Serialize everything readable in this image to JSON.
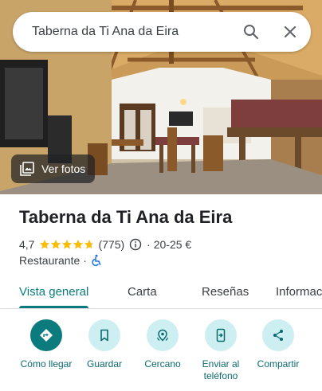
{
  "search": {
    "query": "Taberna da Ti Ana da Eira",
    "search_icon": "search-icon",
    "close_icon": "close-icon"
  },
  "hero": {
    "photos_label": "Ver fotos",
    "photos_icon": "photo-library-icon"
  },
  "place": {
    "title": "Taberna da Ti Ana da Eira",
    "rating": "4,7",
    "stars": 4.7,
    "reviews": "(775)",
    "price": "· 20-25 €",
    "category": "Restaurante",
    "category_sep": "·",
    "accessibility_icon": "wheelchair-icon"
  },
  "tabs": [
    {
      "label": "Vista general",
      "active": true
    },
    {
      "label": "Carta",
      "active": false
    },
    {
      "label": "Reseñas",
      "active": false
    },
    {
      "label": "Informac",
      "active": false
    }
  ],
  "actions": [
    {
      "label": "Cómo llegar",
      "icon": "directions-icon"
    },
    {
      "label": "Guardar",
      "icon": "bookmark-icon"
    },
    {
      "label": "Cercano",
      "icon": "nearby-icon"
    },
    {
      "label": "Enviar al teléfono",
      "icon": "send-to-phone-icon"
    },
    {
      "label": "Compartir",
      "icon": "share-icon"
    }
  ],
  "colors": {
    "accent": "#0b7b7d",
    "accent_light": "#cdeff1",
    "star": "#fbbc04",
    "accessibility": "#1a73e8"
  }
}
